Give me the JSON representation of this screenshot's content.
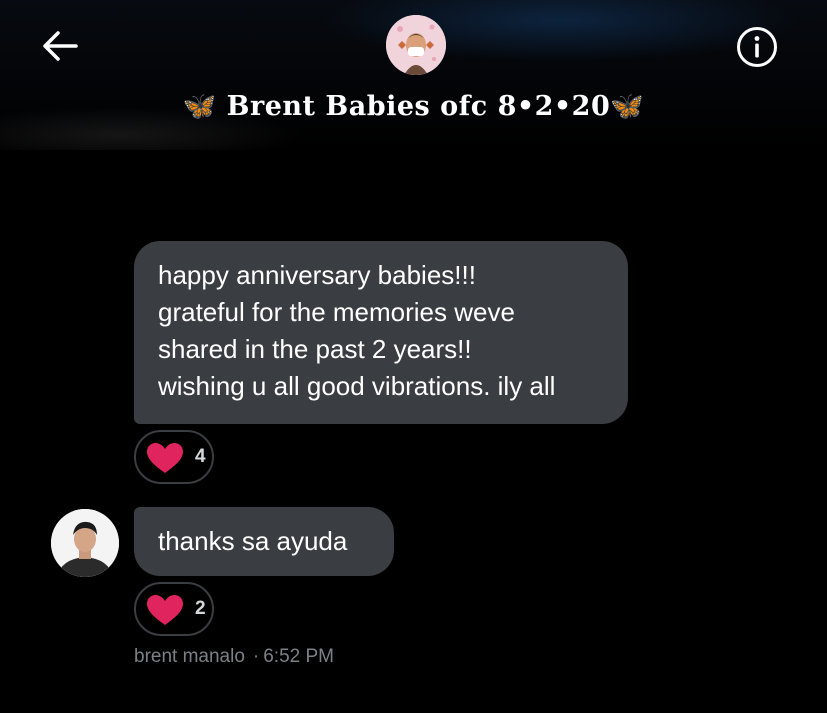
{
  "header": {
    "back_icon": "arrow-left-icon",
    "info_icon": "info-circle-icon",
    "title_prefix_emoji": "🦋",
    "title": "Brent Babies ofc 8•2•20",
    "title_suffix_emoji": "🦋"
  },
  "messages": [
    {
      "lines": [
        "happy anniversary babies!!!",
        "grateful for the memories weve",
        "shared in the past 2 years!!",
        "wishing u all good vibrations. ily all"
      ],
      "reaction": {
        "icon": "heart-icon",
        "count": "4"
      }
    },
    {
      "text": "thanks sa ayuda",
      "reaction": {
        "icon": "heart-icon",
        "count": "2"
      },
      "sender": "brent manalo",
      "separator": "·",
      "time": "6:52 PM"
    }
  ],
  "colors": {
    "background": "#000000",
    "bubble": "#3a3d41",
    "heart": "#e0245e",
    "meta_text": "#7c8186"
  }
}
